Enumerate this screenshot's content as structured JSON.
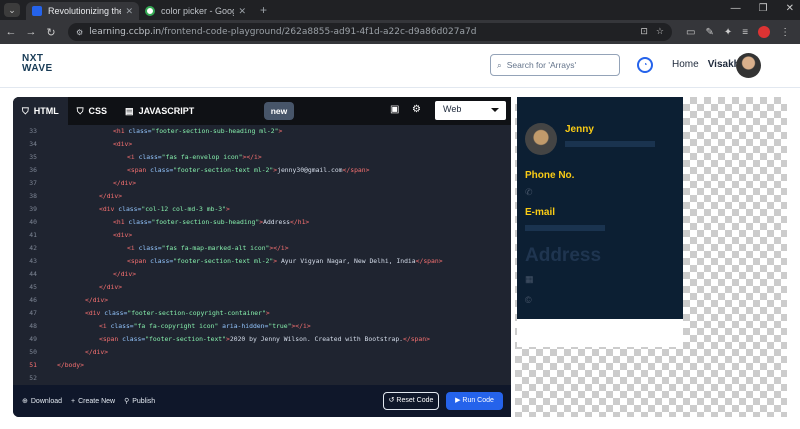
{
  "browser": {
    "tabs": [
      {
        "title": "Revolutionizing the Job Market",
        "active": true,
        "favicon_color": "#2563eb"
      },
      {
        "title": "color picker - Google Search",
        "active": false,
        "favicon_color": "#34a853"
      }
    ],
    "url": "learning.ccbp.in/frontend-code-playground/262a8855-ad91-4f1d-a22c-d9a86d027a7d",
    "url_host": "learning.ccbp.in",
    "url_path": "/frontend-code-playground/262a8855-ad91-4f1d-a22c-d9a86d027a7d"
  },
  "header": {
    "logo_line1": "NXT",
    "logo_line2": "WAVE",
    "search_placeholder": "Search for 'Arrays'",
    "nav_home": "Home",
    "user_name": "Visakh"
  },
  "editor": {
    "tabs": [
      "HTML",
      "CSS",
      "JAVASCRIPT"
    ],
    "new_label": "new",
    "view_select": "Web",
    "footer": {
      "download": "Download",
      "create_new": "Create New",
      "publish": "Publish",
      "reset": "Reset Code",
      "run": "Run Code"
    }
  },
  "code_lines": [
    {
      "n": "33",
      "indent": 10,
      "html": "<span class='tag'>&lt;h1</span> <span class='attr'>class=</span><span class='str'>\"footer-section-sub-heading ml-2\"</span><span class='tag'>&gt;</span>"
    },
    {
      "n": "34",
      "indent": 10,
      "html": "<span class='tag'>&lt;div&gt;</span>"
    },
    {
      "n": "35",
      "indent": 12,
      "html": "<span class='tag'>&lt;i</span> <span class='attr'>class=</span><span class='str'>\"fas fa-envelop icon\"</span><span class='tag'>&gt;&lt;/i&gt;</span>"
    },
    {
      "n": "36",
      "indent": 12,
      "html": "<span class='tag'>&lt;span</span> <span class='attr'>class=</span><span class='str'>\"footer-section-text ml-2\"</span><span class='tag'>&gt;</span>jenny30@gmail.com<span class='tag'>&lt;/span&gt;</span>"
    },
    {
      "n": "37",
      "indent": 10,
      "html": "<span class='tag'>&lt;/div&gt;</span>"
    },
    {
      "n": "38",
      "indent": 8,
      "html": "<span class='tag'>&lt;/div&gt;</span>"
    },
    {
      "n": "39",
      "indent": 8,
      "html": "<span class='tag'>&lt;div</span> <span class='attr'>class=</span><span class='str'>\"col-12 col-md-3 mb-3\"</span><span class='tag'>&gt;</span>"
    },
    {
      "n": "40",
      "indent": 10,
      "html": "<span class='tag'>&lt;h1</span> <span class='attr'>class=</span><span class='str'>\"footer-section-sub-heading\"</span><span class='tag'>&gt;</span>Address<span class='tag'>&lt;/h1&gt;</span>"
    },
    {
      "n": "41",
      "indent": 10,
      "html": "<span class='tag'>&lt;div&gt;</span>"
    },
    {
      "n": "42",
      "indent": 12,
      "html": "<span class='tag'>&lt;i</span> <span class='attr'>class=</span><span class='str'>\"fas fa-map-marked-alt icon\"</span><span class='tag'>&gt;&lt;/i&gt;</span>"
    },
    {
      "n": "43",
      "indent": 12,
      "html": "<span class='tag'>&lt;span</span> <span class='attr'>class=</span><span class='str'>\"footer-section-text ml-2\"</span><span class='tag'>&gt;</span> Ayur Vigyan Nagar, New Delhi, India<span class='tag'>&lt;/span&gt;</span>"
    },
    {
      "n": "44",
      "indent": 10,
      "html": "<span class='tag'>&lt;/div&gt;</span>"
    },
    {
      "n": "45",
      "indent": 8,
      "html": "<span class='tag'>&lt;/div&gt;</span>"
    },
    {
      "n": "46",
      "indent": 6,
      "html": "<span class='tag'>&lt;/div&gt;</span>"
    },
    {
      "n": "47",
      "indent": 6,
      "html": "<span class='tag'>&lt;div</span> <span class='attr'>class=</span><span class='str'>\"footer-section-copyright-container\"</span><span class='tag'>&gt;</span>"
    },
    {
      "n": "48",
      "indent": 8,
      "html": "<span class='tag'>&lt;i</span> <span class='attr'>class=</span><span class='str'>\"fa fa-copyright icon\"</span> <span class='attr'>aria-hidden=</span><span class='str'>\"true\"</span><span class='tag'>&gt;&lt;/i&gt;</span>"
    },
    {
      "n": "49",
      "indent": 8,
      "html": "<span class='tag'>&lt;span</span> <span class='attr'>class=</span><span class='str'>\"footer-section-text\"</span><span class='tag'>&gt;</span>2020 by Jenny Wilson. Created with Bootstrap.<span class='tag'>&lt;/span&gt;</span>"
    },
    {
      "n": "50",
      "indent": 6,
      "html": "<span class='tag'>&lt;/div&gt;</span>"
    },
    {
      "n": "51",
      "indent": 2,
      "html": "<span class='tag'>&lt;/body&gt;</span>"
    },
    {
      "n": "52",
      "indent": 0,
      "html": ""
    }
  ],
  "preview": {
    "name": "Jenny",
    "phone_heading": "Phone No.",
    "email_heading": "E-mail",
    "address_heading": "Address"
  }
}
